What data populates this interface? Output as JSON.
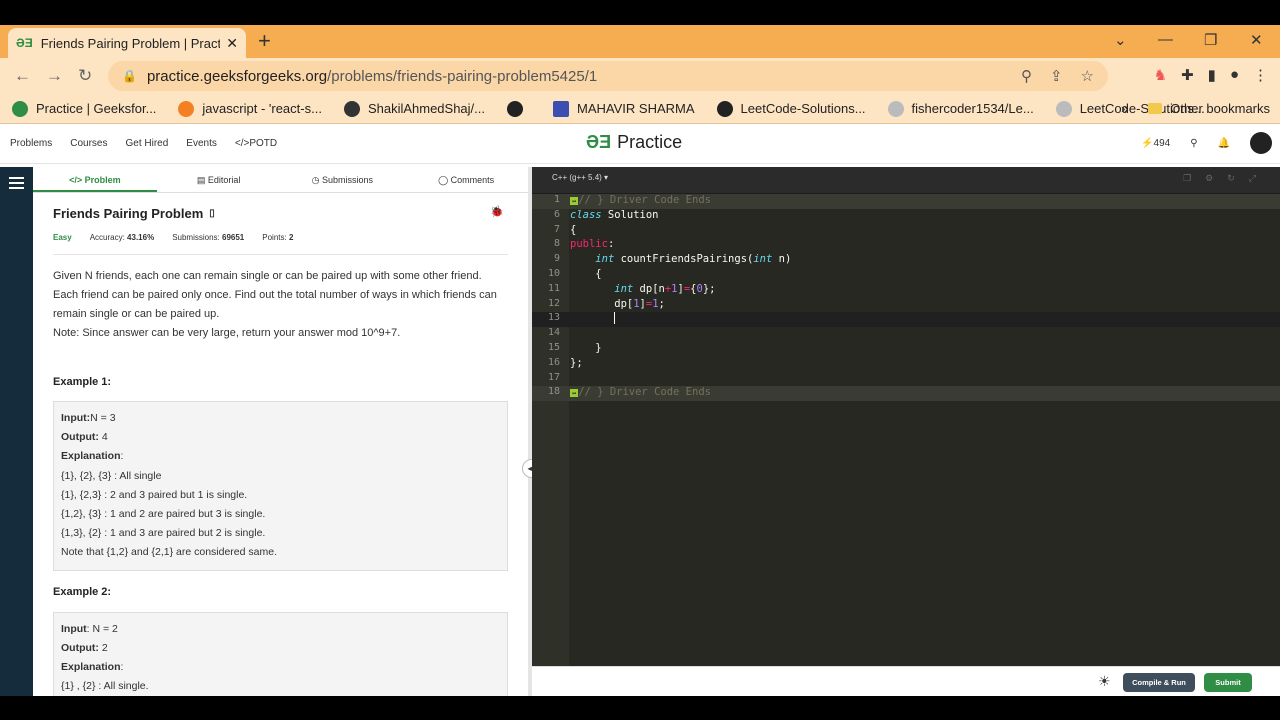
{
  "browser": {
    "tab_title": "Friends Pairing Problem | Practice",
    "url_host": "practice.geeksforgeeks.org",
    "url_path": "/problems/friends-pairing-problem5425/1",
    "new_tab": "+",
    "bookmarks": [
      {
        "label": "Practice | Geeksfor..."
      },
      {
        "label": "javascript - 'react-s..."
      },
      {
        "label": "ShakilAhmedShaj/..."
      },
      {
        "label": ""
      },
      {
        "label": "MAHAVIR SHARMA"
      },
      {
        "label": "LeetCode-Solutions..."
      },
      {
        "label": "fishercoder1534/Le..."
      },
      {
        "label": "LeetCode-Solutions..."
      }
    ],
    "more_bookmarks": "»",
    "other_bookmarks": "Other bookmarks"
  },
  "site": {
    "nav": [
      "Problems",
      "Courses",
      "Get Hired",
      "Events",
      "</>POTD"
    ],
    "logo_text": "Practice",
    "streak": "494"
  },
  "problem": {
    "tabs": [
      "</> Problem",
      "Editorial",
      "Submissions",
      "Comments"
    ],
    "title": "Friends Pairing Problem",
    "difficulty": "Easy",
    "accuracy_label": "Accuracy:",
    "accuracy": "43.16%",
    "submissions_label": "Submissions:",
    "submissions": "69651",
    "points_label": "Points:",
    "points": "2",
    "description": [
      "Given N friends, each one can remain single or can be paired up with some other friend.",
      "Each friend can be paired only once. Find out the total number of ways in which friends can",
      "remain single or can be paired up.",
      "Note: Since answer can be very large, return your answer mod 10^9+7."
    ],
    "example1": {
      "heading": "Example 1:",
      "input_label": "Input:",
      "input": "N = 3",
      "output_label": "Output:",
      "output": "4",
      "explanation_label": "Explanation",
      "lines": [
        "{1}, {2}, {3} : All single",
        "{1}, {2,3} : 2 and 3 paired but 1 is single.",
        "{1,2}, {3} : 1 and 2 are paired but 3 is single.",
        "{1,3}, {2} : 1 and 3 are paired but 2 is single.",
        "Note that {1,2} and {2,1} are considered same."
      ]
    },
    "example2": {
      "heading": "Example 2:",
      "input_label": "Input",
      "input": ": N = 2",
      "output_label": "Output:",
      "output": "2",
      "explanation_label": "Explanation",
      "lines": [
        "{1} , {2} : All single."
      ]
    }
  },
  "editor": {
    "language": "C++ (g++ 5.4) ▾",
    "line_numbers": [
      "1",
      "6",
      "7",
      "8",
      "9",
      "10",
      "11",
      "12",
      "13",
      "14",
      "15",
      "16",
      "17",
      "18"
    ],
    "fold_marker": "↔",
    "driver_comment": "// } Driver Code Ends",
    "run_label": "Compile & Run",
    "submit_label": "Submit"
  }
}
